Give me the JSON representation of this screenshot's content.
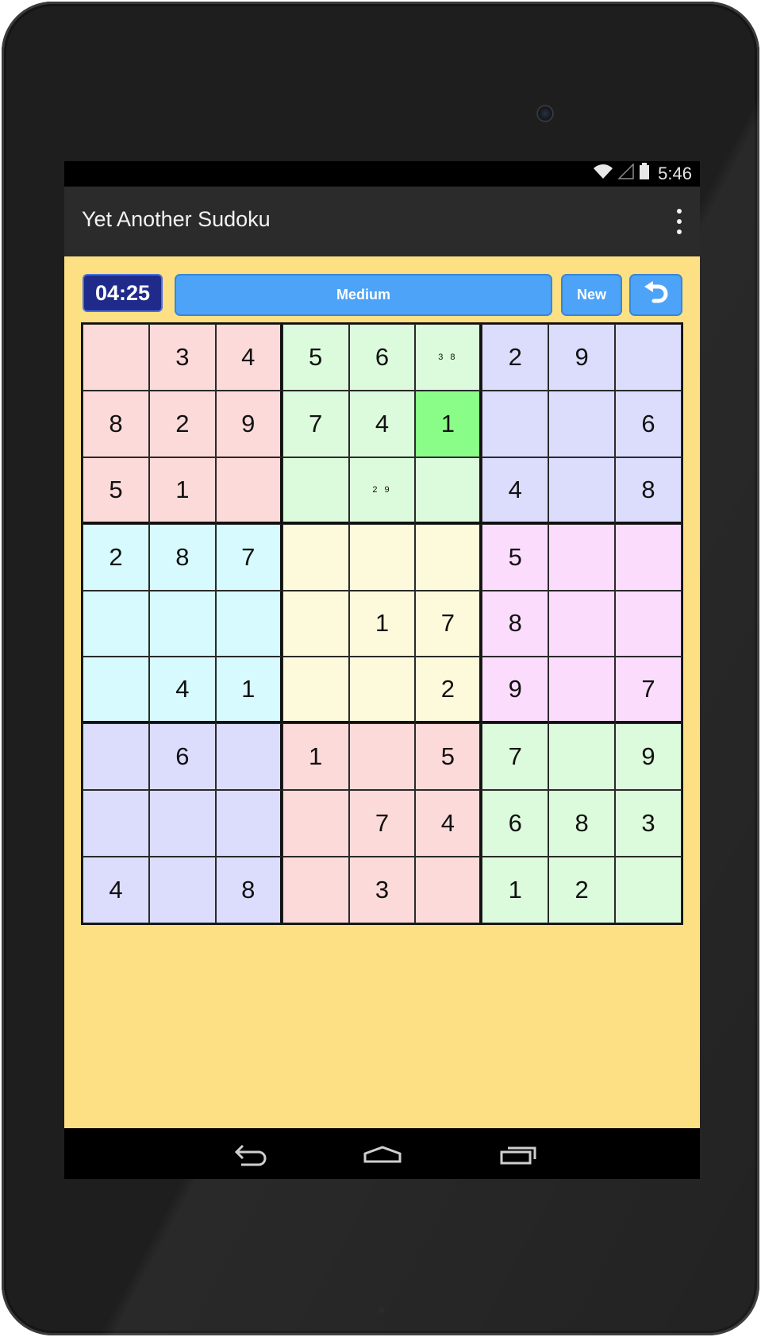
{
  "status_bar": {
    "time": "5:46"
  },
  "action_bar": {
    "title": "Yet Another Sudoku",
    "menu_icon": "overflow-menu-icon"
  },
  "game": {
    "timer": "04:25",
    "difficulty_label": "Medium",
    "new_label": "New",
    "undo_icon": "undo-icon"
  },
  "board": {
    "box_colors": [
      "#fddada",
      "#dcfadc",
      "#dcdcfd",
      "#d6fafd",
      "#fdfadb",
      "#fcdcfd",
      "#dcdcfd",
      "#fddada",
      "#dcfadc"
    ],
    "highlight_color": "#8afd88",
    "selected": {
      "row": 1,
      "col": 5
    },
    "cells": [
      [
        "",
        "3",
        "4",
        "5",
        "6",
        "38",
        "2",
        "9",
        ""
      ],
      [
        "8",
        "2",
        "9",
        "7",
        "4",
        "1",
        "",
        "",
        "6"
      ],
      [
        "5",
        "1",
        "",
        "",
        "29",
        "",
        "4",
        "",
        "8"
      ],
      [
        "2",
        "8",
        "7",
        "",
        "",
        "",
        "5",
        "",
        ""
      ],
      [
        "",
        "",
        "",
        "",
        "1",
        "7",
        "8",
        "",
        ""
      ],
      [
        "",
        "4",
        "1",
        "",
        "",
        "2",
        "9",
        "",
        "7"
      ],
      [
        "",
        "6",
        "",
        "1",
        "",
        "5",
        "7",
        "",
        "9"
      ],
      [
        "",
        "",
        "",
        "",
        "7",
        "4",
        "6",
        "8",
        "3"
      ],
      [
        "4",
        "",
        "8",
        "",
        "3",
        "",
        "1",
        "2",
        ""
      ]
    ],
    "notes": [
      [
        0,
        5
      ],
      [
        2,
        4
      ]
    ]
  },
  "nav_bar": {
    "back_icon": "back-icon",
    "home_icon": "home-icon",
    "recents_icon": "recents-icon"
  }
}
